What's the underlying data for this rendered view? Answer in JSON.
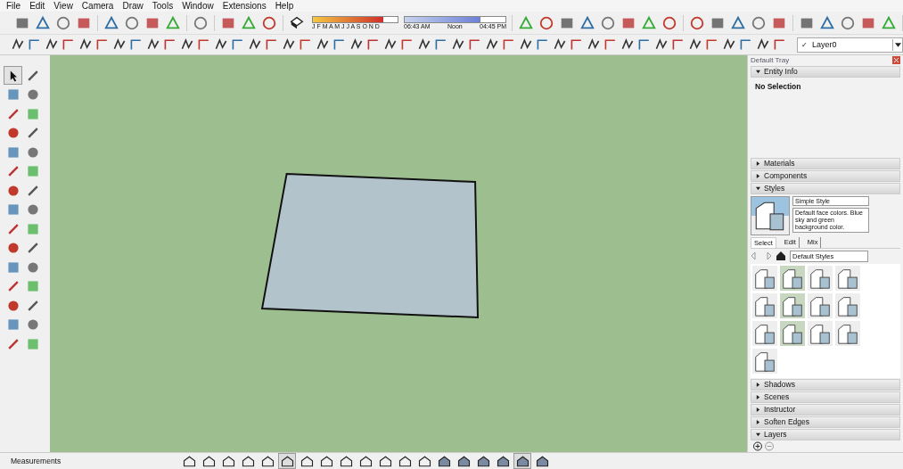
{
  "menu_bar": [
    "File",
    "Edit",
    "View",
    "Camera",
    "Draw",
    "Tools",
    "Window",
    "Extensions",
    "Help"
  ],
  "shadow_toolbar": {
    "months": "J F M A M J J A S O N D",
    "month_slider": {
      "level": 0.83
    },
    "time_start": "06:43 AM",
    "time_mid": "Noon",
    "time_end": "04:45 PM",
    "time_slider": {
      "level": 0.75
    }
  },
  "layer_dropdown": {
    "value": "Layer0",
    "checkmark": "✓"
  },
  "left_toolbar": {
    "tools": [
      {
        "selected": true
      },
      {
        "selected": false
      },
      {
        "selected": false
      },
      {
        "selected": false
      },
      {
        "selected": false
      },
      {
        "selected": false
      },
      {
        "selected": false
      },
      {
        "selected": false
      },
      {
        "selected": false
      },
      {
        "selected": false
      },
      {
        "selected": false
      },
      {
        "selected": false
      },
      {
        "selected": false
      },
      {
        "selected": false
      },
      {
        "selected": false
      },
      {
        "selected": false
      },
      {
        "selected": false
      },
      {
        "selected": false
      },
      {
        "selected": false
      },
      {
        "selected": false
      },
      {
        "selected": false
      },
      {
        "selected": false
      },
      {
        "selected": false
      },
      {
        "selected": false
      },
      {
        "selected": false
      },
      {
        "selected": false
      },
      {
        "selected": false
      },
      {
        "selected": false
      },
      {
        "selected": false
      },
      {
        "selected": false
      }
    ]
  },
  "tray": {
    "title": "Default Tray",
    "entity_info": {
      "title": "Entity Info",
      "expanded": true,
      "value": "No Selection"
    },
    "panels_top": [
      {
        "title": "Materials",
        "expanded": false
      },
      {
        "title": "Components",
        "expanded": false
      },
      {
        "title": "Styles",
        "expanded": true
      }
    ],
    "styles": {
      "name": "Simple Style",
      "description": "Default face colors. Blue sky and green background color.",
      "tabs": [
        {
          "label": "Select",
          "selected": true
        },
        {
          "label": "Edit",
          "selected": false
        },
        {
          "label": "Mix",
          "selected": false
        }
      ],
      "collection": "Default Styles"
    },
    "panels_bottom": [
      {
        "title": "Shadows",
        "expanded": false
      },
      {
        "title": "Scenes",
        "expanded": false
      },
      {
        "title": "Instructor",
        "expanded": false
      },
      {
        "title": "Soften Edges",
        "expanded": false
      },
      {
        "title": "Layers",
        "expanded": true
      }
    ]
  },
  "status_bar": {
    "label": "Measurements",
    "tools": [
      {
        "selected": false
      },
      {
        "selected": false
      },
      {
        "selected": false
      },
      {
        "selected": false
      },
      {
        "selected": false
      },
      {
        "selected": true
      },
      {
        "selected": false
      },
      {
        "selected": false
      },
      {
        "selected": false
      },
      {
        "selected": false
      },
      {
        "selected": false
      },
      {
        "selected": false
      },
      {
        "selected": false
      },
      {
        "selected": false
      },
      {
        "selected": false
      },
      {
        "selected": false
      },
      {
        "selected": false
      },
      {
        "selected": true
      },
      {
        "selected": false
      }
    ]
  }
}
